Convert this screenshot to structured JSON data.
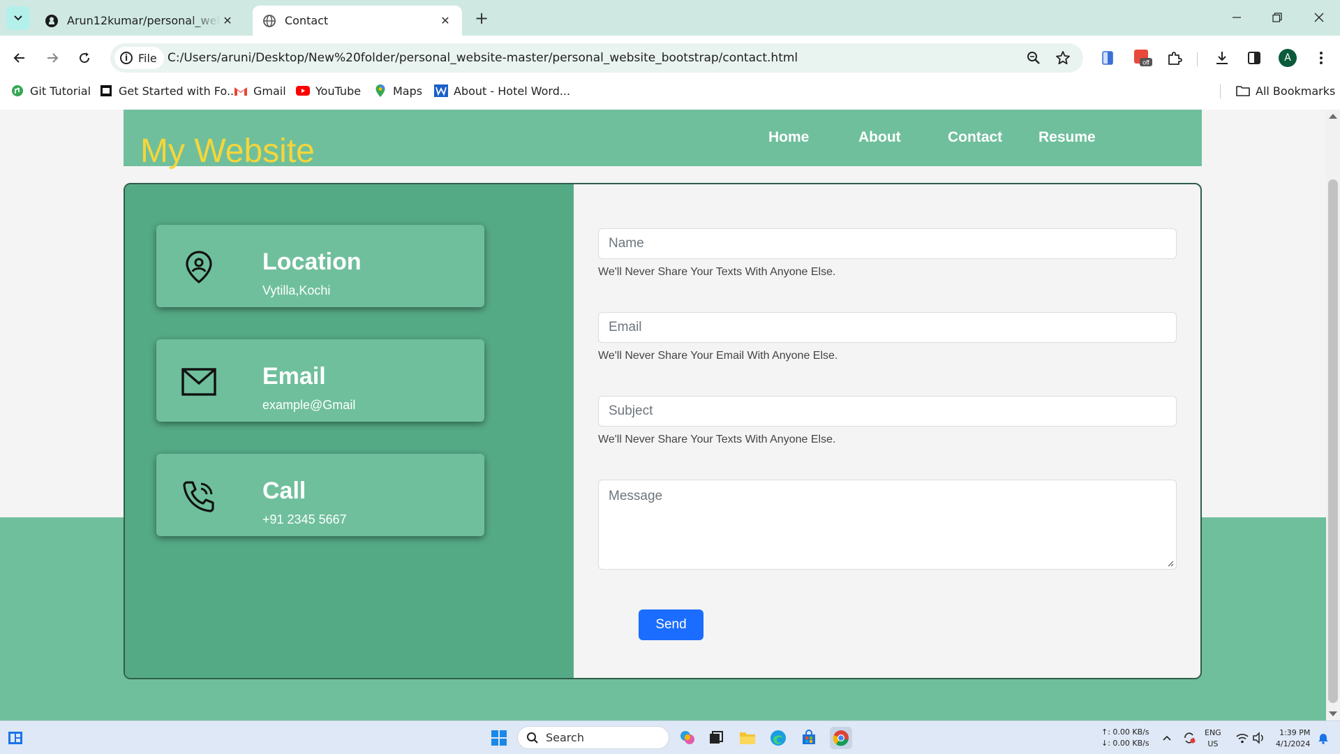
{
  "browser": {
    "tabs": [
      {
        "title": "Arun12kumar/personal_website"
      },
      {
        "title": "Contact"
      }
    ],
    "site_chip": "File",
    "url": "C:/Users/aruni/Desktop/New%20folder/personal_website-master/personal_website_bootstrap/contact.html",
    "avatar_letter": "A",
    "bookmarks": [
      {
        "label": "Git Tutorial"
      },
      {
        "label": "Get Started with Fo..."
      },
      {
        "label": "Gmail"
      },
      {
        "label": "YouTube"
      },
      {
        "label": "Maps"
      },
      {
        "label": "About - Hotel Word..."
      }
    ],
    "all_bookmarks": "All Bookmarks"
  },
  "site": {
    "brand": "My Website",
    "nav": [
      "Home",
      "About",
      "Contact",
      "Resume"
    ]
  },
  "contact": {
    "cards": [
      {
        "title": "Location",
        "value": "Vytilla,Kochi",
        "icon": "location-pin-icon"
      },
      {
        "title": "Email",
        "value": "example@Gmail",
        "icon": "envelope-icon"
      },
      {
        "title": "Call",
        "value": "+91 2345 5667",
        "icon": "phone-icon"
      }
    ],
    "form": {
      "name_placeholder": "Name",
      "name_help": "We'll Never Share Your Texts With Anyone Else.",
      "email_placeholder": "Email",
      "email_help": "We'll Never Share Your Email With Anyone Else.",
      "subject_placeholder": "Subject",
      "subject_help": "We'll Never Share Your Texts With Anyone Else.",
      "message_placeholder": "Message",
      "send_label": "Send"
    }
  },
  "taskbar": {
    "search_label": "Search",
    "net_up": "↑: 0.00 KB/s",
    "net_down": "↓: 0.00 KB/s",
    "lang": "ENG",
    "region": "US",
    "time": "1:39 PM",
    "date": "4/1/2024"
  },
  "colors": {
    "primary_green": "#6fbf9c",
    "dark_green": "#55aa86",
    "brand_yellow": "#f5d63a",
    "send_blue": "#1a6dff"
  }
}
